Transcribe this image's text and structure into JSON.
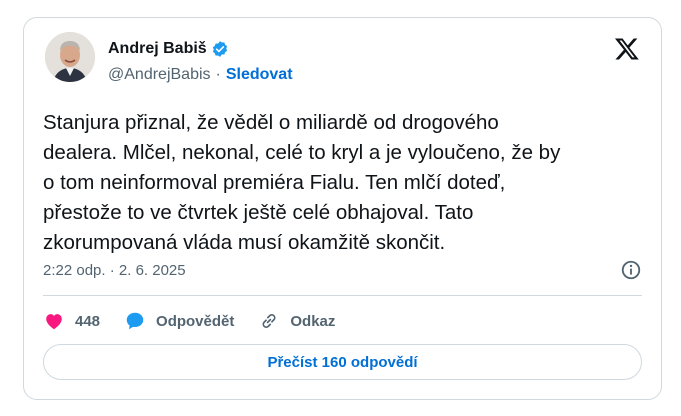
{
  "author": {
    "name": "Andrej Babiš",
    "handle": "@AndrejBabis",
    "separator": "·",
    "follow_label": "Sledovat"
  },
  "tweet": {
    "text": "Stanjura přiznal, že věděl o miliardě od drogového\ndealera. Mlčel, nekonal, celé to kryl a je vyloučeno, že by\no tom neinformoval premiéra Fialu. Ten mlčí doteď,\npřestože to ve čtvrtek ještě celé obhajoval. Tato\nzkorumpovaná vláda musí okamžitě skončit.",
    "timestamp": "2:22 odp. · 2. 6. 2025"
  },
  "actions": {
    "likes": "448",
    "reply_label": "Odpovědět",
    "link_label": "Odkaz"
  },
  "read_replies_label": "Přečíst 160 odpovědí",
  "icons": {
    "verified": "verified-badge-icon",
    "platform": "x-logo-icon",
    "info": "info-icon",
    "like": "heart-icon",
    "reply": "speech-bubble-icon",
    "link": "chain-link-icon"
  },
  "colors": {
    "accent": "#006fd6",
    "like": "#f91880",
    "reply": "#1d9bf0",
    "secondary_text": "#536471",
    "border": "#cfd9de"
  }
}
